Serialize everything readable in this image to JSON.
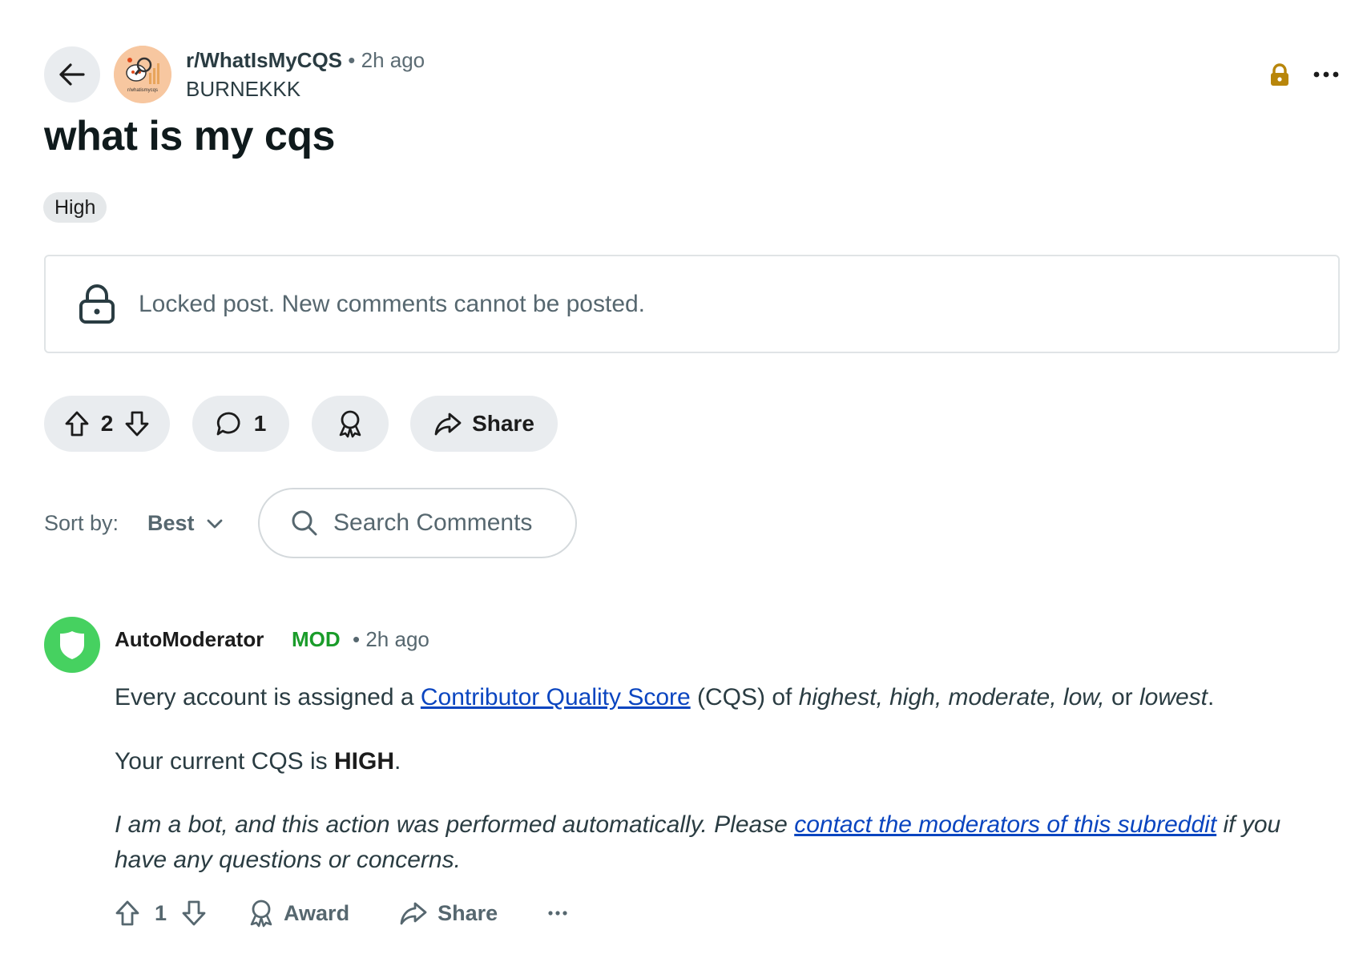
{
  "post": {
    "subreddit": "r/WhatIsMyCQS",
    "separator": "•",
    "time": "2h ago",
    "author": "BURNEKKK",
    "avatar_text": "r/whatismycqs",
    "title": "what is my cqs",
    "flair": "High",
    "locked_message": "Locked post. New comments cannot be posted.",
    "votes": "2",
    "comments": "1",
    "share_label": "Share"
  },
  "sort": {
    "label": "Sort by:",
    "value": "Best"
  },
  "search": {
    "placeholder": "Search Comments"
  },
  "comment": {
    "author": "AutoModerator",
    "badge": "MOD",
    "separator": "•",
    "time": "2h ago",
    "p1_start": "Every account is assigned a ",
    "p1_link": "Contributor Quality Score",
    "p1_mid": " (CQS) of ",
    "p1_levels": "highest, high, moderate, low,",
    "p1_or": " or ",
    "p1_lowest": "lowest",
    "p1_end": ".",
    "p2_start": "Your current CQS is ",
    "p2_value": "HIGH",
    "p2_end": ".",
    "p3_start": "I am a bot, and this action was performed automatically. Please ",
    "p3_link": "contact the moderators of this subreddit",
    "p3_end": " if you have any questions or concerns.",
    "votes": "1",
    "award_label": "Award",
    "share_label": "Share"
  },
  "colors": {
    "accent_link": "#0a45c0",
    "mod_green": "#1a9c2a",
    "lock_gold": "#b8860b"
  }
}
